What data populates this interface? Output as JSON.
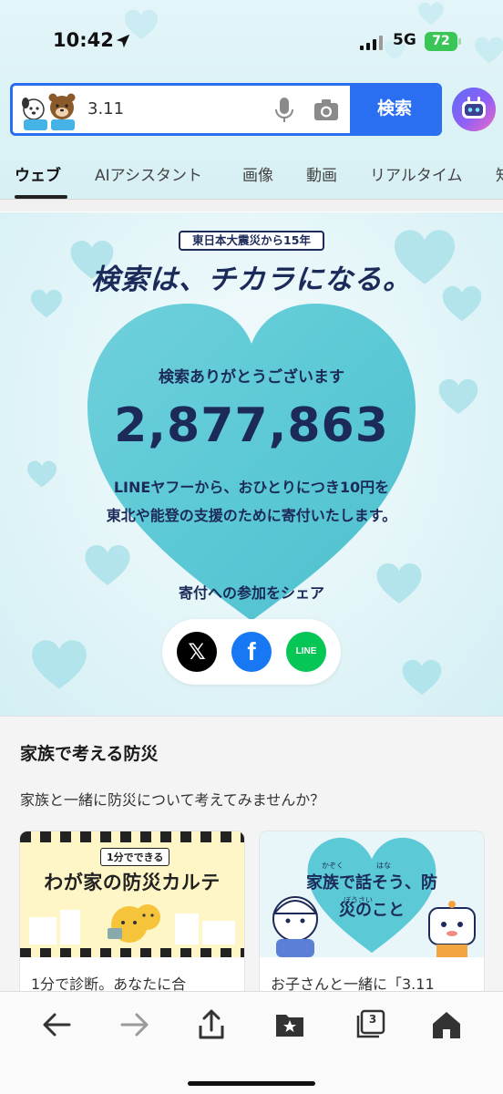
{
  "status_bar": {
    "time": "10:42",
    "network": "5G",
    "battery": "72"
  },
  "search": {
    "query": "3.11",
    "button_label": "検索"
  },
  "tabs": [
    {
      "label": "ウェブ",
      "active": true
    },
    {
      "label": "AIアシスタント",
      "active": false
    },
    {
      "label": "画像",
      "active": false
    },
    {
      "label": "動画",
      "active": false
    },
    {
      "label": "リアルタイム",
      "active": false
    },
    {
      "label": "知",
      "active": false
    }
  ],
  "banner": {
    "tag": "東日本大震災から15年",
    "slogan": "検索は、チカラになる。",
    "thanks": "検索ありがとうございます",
    "count": "2,877,863",
    "desc_line1": "LINEヤフーから、おひとりにつき10円を",
    "desc_line2": "東北や能登の支援のために寄付いたします。",
    "share_label": "寄付への参加をシェア",
    "share_x": "𝕏",
    "share_facebook": "f",
    "share_line": "LINE"
  },
  "family_section": {
    "title": "家族で考える防災",
    "subtitle": "家族と一緒に防災について考えてみませんか？",
    "cards": [
      {
        "badge": "1分でできる",
        "headline": "わが家の防災カルテ",
        "text": "1分で診断。あなたに合"
      },
      {
        "headline": "家族で話そう、防災のこと",
        "ruby_1": "かぞく",
        "ruby_2": "はな",
        "ruby_3": "ぼうさい",
        "text": "お子さんと一緒に「3.11"
      }
    ]
  },
  "bottom_bar": {
    "tab_count": "3"
  },
  "colors": {
    "accent_blue": "#2a6ff2",
    "navy": "#1c2a5a",
    "heart": "#5cc9d6"
  },
  "icons": [
    "location-arrow-icon",
    "signal-icon",
    "mascot-icon",
    "mic-icon",
    "camera-icon",
    "ai-assistant-icon",
    "x-logo-icon",
    "facebook-logo-icon",
    "line-logo-icon",
    "back-arrow-icon",
    "forward-arrow-icon",
    "share-icon",
    "bookmark-folder-icon",
    "tabs-icon",
    "home-icon"
  ]
}
